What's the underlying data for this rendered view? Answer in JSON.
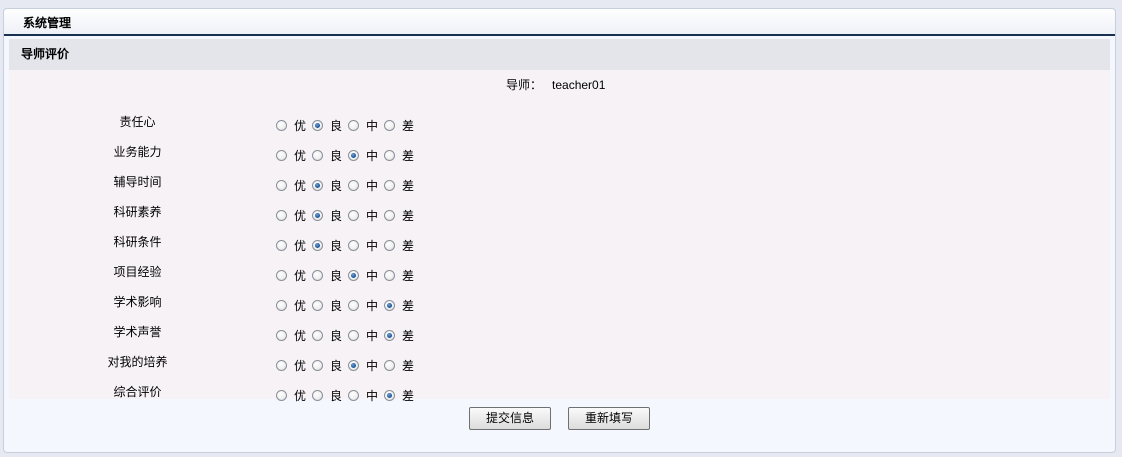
{
  "panel": {
    "title": "系统管理"
  },
  "section": {
    "title": "导师评价"
  },
  "tutor": {
    "label": "导师：",
    "value": "teacher01"
  },
  "options": [
    "优",
    "良",
    "中",
    "差"
  ],
  "criteria": [
    {
      "label": "责任心",
      "selected": 1
    },
    {
      "label": "业务能力",
      "selected": 2
    },
    {
      "label": "辅导时间",
      "selected": 1
    },
    {
      "label": "科研素养",
      "selected": 1
    },
    {
      "label": "科研条件",
      "selected": 1
    },
    {
      "label": "项目经验",
      "selected": 2
    },
    {
      "label": "学术影响",
      "selected": 3
    },
    {
      "label": "学术声誉",
      "selected": 3
    },
    {
      "label": "对我的培养",
      "selected": 2
    },
    {
      "label": "综合评价",
      "selected": 3
    }
  ],
  "buttons": {
    "submit": "提交信息",
    "reset": "重新填写"
  }
}
